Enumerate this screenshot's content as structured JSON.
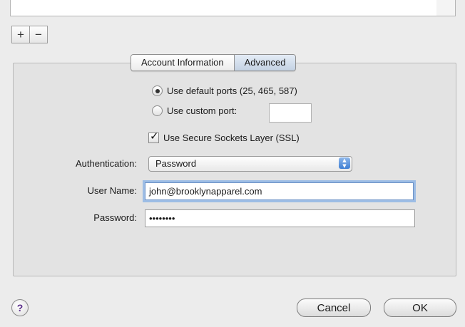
{
  "list": {
    "add_label": "+",
    "remove_label": "−"
  },
  "tabs": [
    {
      "label": "Account Information",
      "selected": false
    },
    {
      "label": "Advanced",
      "selected": true
    }
  ],
  "ports": {
    "default_label": "Use default ports (25, 465, 587)",
    "default_selected": true,
    "custom_label": "Use custom port:",
    "custom_value": ""
  },
  "ssl": {
    "label": "Use Secure Sockets Layer (SSL)",
    "checked": true
  },
  "auth": {
    "label": "Authentication:",
    "value": "Password"
  },
  "username": {
    "label": "User Name:",
    "value": "john@brooklynapparel.com"
  },
  "password": {
    "label": "Password:",
    "value": "••••••••"
  },
  "footer": {
    "help_label": "?",
    "cancel_label": "Cancel",
    "ok_label": "OK"
  },
  "icons": {
    "help": "help-icon",
    "popup_arrows": "up-down-arrows-icon",
    "checkmark": "checkmark-icon"
  }
}
